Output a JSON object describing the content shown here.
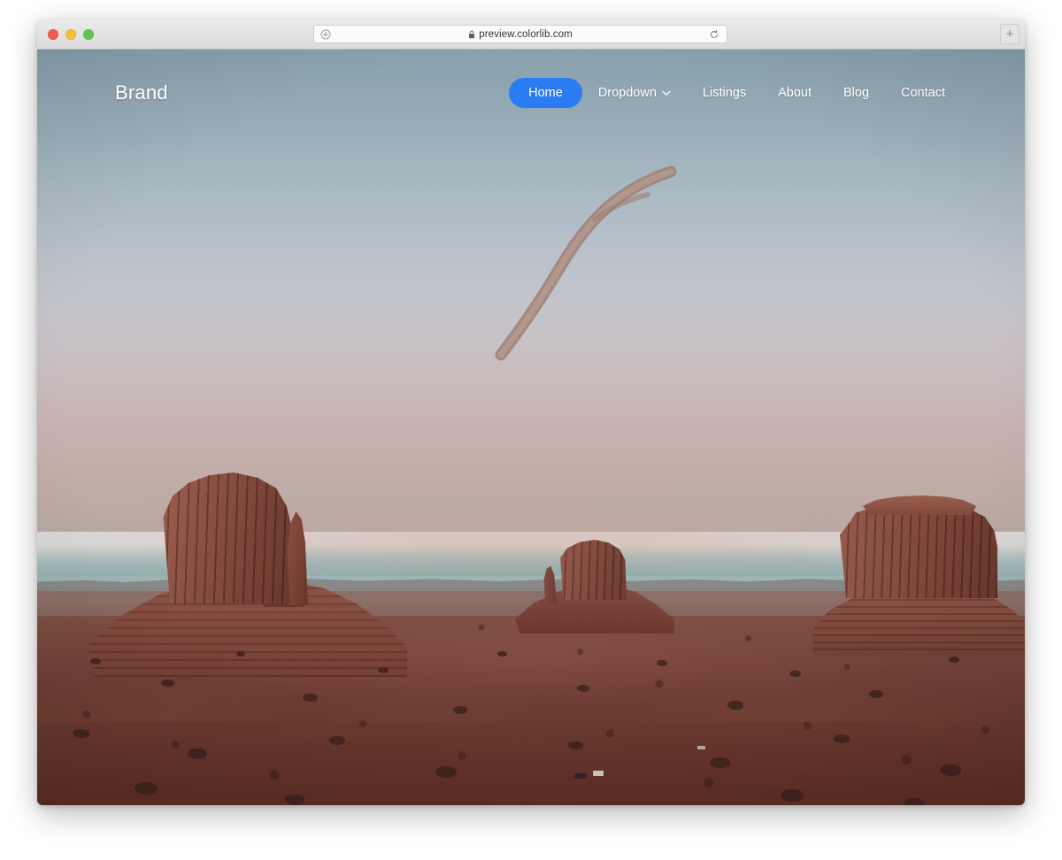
{
  "browser": {
    "traffic_lights": [
      {
        "name": "close",
        "color": "#f05a4f"
      },
      {
        "name": "minimize",
        "color": "#f6bd3b"
      },
      {
        "name": "zoom",
        "color": "#61c554"
      }
    ],
    "url_bar": {
      "url": "preview.colorlib.com",
      "lock_icon": "lock-icon",
      "reader_icon": "reader-view-icon",
      "reload_icon": "reload-icon"
    },
    "new_tab_label": "+"
  },
  "site": {
    "brand": "Brand",
    "accent_color": "#2b7bf3",
    "nav": [
      {
        "label": "Home",
        "active": true,
        "icon": null
      },
      {
        "label": "Dropdown",
        "active": false,
        "icon": "chevron-down-icon"
      },
      {
        "label": "Listings",
        "active": false,
        "icon": null
      },
      {
        "label": "About",
        "active": false,
        "icon": null
      },
      {
        "label": "Blog",
        "active": false,
        "icon": null
      },
      {
        "label": "Contact",
        "active": false,
        "icon": null
      }
    ]
  },
  "hero": {
    "scene": "Monument Valley buttes at dusk",
    "sky_top_color": "#87a0ad",
    "sky_horizon_color": "#c9b9ba",
    "teal_band_color": "#86a8a8",
    "desert_floor_color": "#6e3d34",
    "rock_color": "#7d4539",
    "landmarks": [
      {
        "name": "West Mitten Butte"
      },
      {
        "name": "East Mitten Butte"
      },
      {
        "name": "Merrick Butte"
      }
    ],
    "vehicles": [
      {
        "name": "vehicle-dark"
      },
      {
        "name": "vehicle-light"
      },
      {
        "name": "vehicle-far"
      }
    ]
  }
}
